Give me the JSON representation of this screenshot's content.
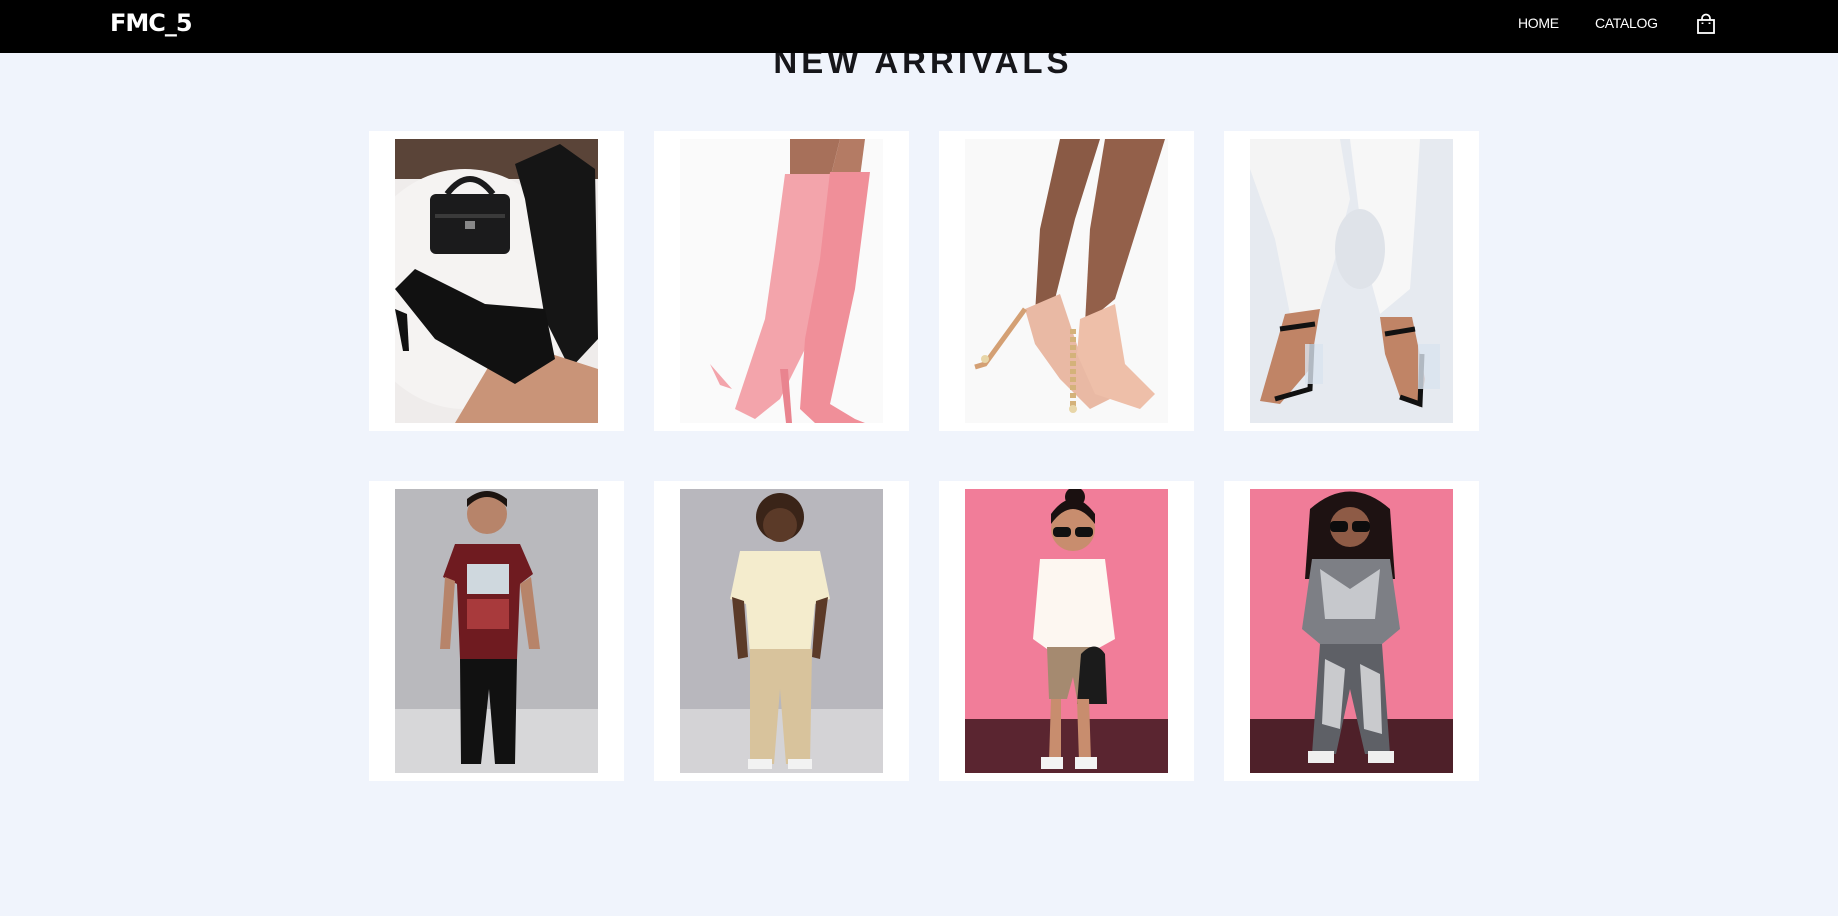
{
  "header": {
    "logo": "FMC_5",
    "nav": {
      "home": "HOME",
      "catalog": "CATALOG"
    },
    "cart_icon": "shopping-bag-icon"
  },
  "main": {
    "title": "NEW ARRIVALS",
    "products": [
      {
        "image": "black over-the-knee boots with black handbag on white fur rug"
      },
      {
        "image": "pink suede thigh-high stiletto boots"
      },
      {
        "image": "nude patent strappy heels with pearl heel"
      },
      {
        "image": "black strappy sandals with clear block heel and white pants"
      },
      {
        "image": "boy in burgundy New York graphic tee and black pants"
      },
      {
        "image": "boy in cream tee and khaki pants"
      },
      {
        "image": "girl in sunglasses, white fuzzy top and biker shorts on pink background"
      },
      {
        "image": "girl in sunglasses and grey tie-dye hoodie set on pink background"
      }
    ]
  },
  "colors": {
    "header_bg": "#000000",
    "page_bg": "#f0f4fc",
    "card_bg": "#ffffff",
    "title_text": "#16161a"
  }
}
